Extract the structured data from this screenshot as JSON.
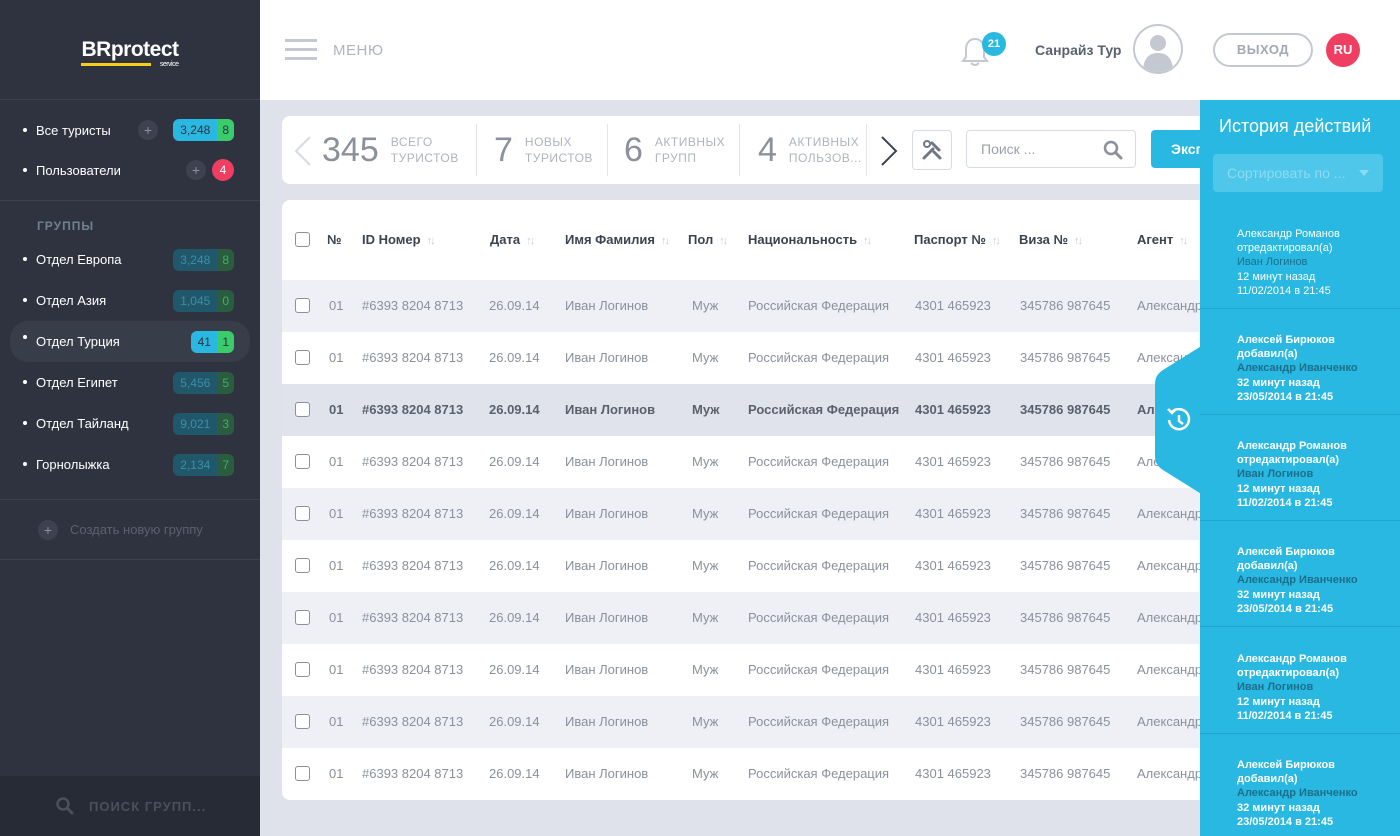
{
  "logo": {
    "brand": "BRprotect",
    "sub": "service"
  },
  "header": {
    "menu_label": "МЕНЮ",
    "notifications": "21",
    "user_name": "Санрайз Тур",
    "logout": "ВЫХОД",
    "lang": "RU"
  },
  "sidebar": {
    "top_items": [
      {
        "label": "Все туристы",
        "count": "3,248",
        "sub": "8"
      },
      {
        "label": "Пользователи",
        "count": "4"
      }
    ],
    "groups_title": "ГРУППЫ",
    "groups": [
      {
        "label": "Отдел Европа",
        "count": "3,248",
        "sub": "8"
      },
      {
        "label": "Отдел Азия",
        "count": "1,045",
        "sub": "0"
      },
      {
        "label": "Отдел Турция",
        "count": "41",
        "sub": "1"
      },
      {
        "label": "Отдел Египет",
        "count": "5,456",
        "sub": "5"
      },
      {
        "label": "Отдел Тайланд",
        "count": "9,021",
        "sub": "3"
      },
      {
        "label": "Горнолыжка",
        "count": "2,134",
        "sub": "7"
      }
    ],
    "create_group": "Создать новую группу",
    "search_placeholder": "ПОИСК ГРУПП..."
  },
  "stats": [
    {
      "num": "345",
      "l1": "ВСЕГО",
      "l2": "ТУРИСТОВ"
    },
    {
      "num": "7",
      "l1": "НОВЫХ",
      "l2": "ТУРИСТОВ"
    },
    {
      "num": "6",
      "l1": "АКТИВНЫХ",
      "l2": "ГРУПП"
    },
    {
      "num": "4",
      "l1": "АКТИВНЫХ",
      "l2": "ПОЛЬЗОВ..."
    }
  ],
  "toolbar": {
    "search_placeholder": "Поиск ...",
    "export_label": "Экспорт"
  },
  "table": {
    "headers": [
      "№",
      "ID Номер",
      "Дата",
      "Имя Фамилия",
      "Пол",
      "Национальность",
      "Паспорт №",
      "Виза №",
      "Агент"
    ],
    "rows": [
      {
        "n": "01",
        "id": "#6393 8204 8713",
        "date": "26.09.14",
        "name": "Иван Логинов",
        "sex": "Муж",
        "nat": "Российская Федерация",
        "pass": "4301  465923",
        "visa": "345786 987645",
        "agent": "Александр"
      },
      {
        "n": "01",
        "id": "#6393 8204 8713",
        "date": "26.09.14",
        "name": "Иван Логинов",
        "sex": "Муж",
        "nat": "Российская Федерация",
        "pass": "4301  465923",
        "visa": "345786 987645",
        "agent": "Александр"
      },
      {
        "n": "01",
        "id": "#6393 8204 8713",
        "date": "26.09.14",
        "name": "Иван Логинов",
        "sex": "Муж",
        "nat": "Российская Федерация",
        "pass": "4301  465923",
        "visa": "345786 987645",
        "agent": "Александр"
      },
      {
        "n": "01",
        "id": "#6393 8204 8713",
        "date": "26.09.14",
        "name": "Иван Логинов",
        "sex": "Муж",
        "nat": "Российская Федерация",
        "pass": "4301  465923",
        "visa": "345786 987645",
        "agent": "Александр"
      },
      {
        "n": "01",
        "id": "#6393 8204 8713",
        "date": "26.09.14",
        "name": "Иван Логинов",
        "sex": "Муж",
        "nat": "Российская Федерация",
        "pass": "4301  465923",
        "visa": "345786 987645",
        "agent": "Александр"
      },
      {
        "n": "01",
        "id": "#6393 8204 8713",
        "date": "26.09.14",
        "name": "Иван Логинов",
        "sex": "Муж",
        "nat": "Российская Федерация",
        "pass": "4301  465923",
        "visa": "345786 987645",
        "agent": "Александр"
      },
      {
        "n": "01",
        "id": "#6393 8204 8713",
        "date": "26.09.14",
        "name": "Иван Логинов",
        "sex": "Муж",
        "nat": "Российская Федерация",
        "pass": "4301  465923",
        "visa": "345786 987645",
        "agent": "Александр"
      },
      {
        "n": "01",
        "id": "#6393 8204 8713",
        "date": "26.09.14",
        "name": "Иван Логинов",
        "sex": "Муж",
        "nat": "Российская Федерация",
        "pass": "4301  465923",
        "visa": "345786 987645",
        "agent": "Александр"
      },
      {
        "n": "01",
        "id": "#6393 8204 8713",
        "date": "26.09.14",
        "name": "Иван Логинов",
        "sex": "Муж",
        "nat": "Российская Федерация",
        "pass": "4301  465923",
        "visa": "345786 987645",
        "agent": "Александр"
      },
      {
        "n": "01",
        "id": "#6393 8204 8713",
        "date": "26.09.14",
        "name": "Иван Логинов",
        "sex": "Муж",
        "nat": "Российская Федерация",
        "pass": "4301  465923",
        "visa": "345786 987645",
        "agent": "Александр"
      }
    ]
  },
  "history": {
    "title": "История действий",
    "sort_placeholder": "Сортировать по ...",
    "items": [
      {
        "user": "Александр Романов",
        "action": "отредактировал(а)",
        "target": "Иван Логинов",
        "ago": "12 минут назад",
        "when": "11/02/2014 в 21:45"
      },
      {
        "user": "Алексей Бирюков",
        "action": "добавил(а)",
        "target": "Александр Иванченко",
        "ago": "32 минут назад",
        "when": "23/05/2014 в 21:45"
      },
      {
        "user": "Александр Романов",
        "action": "отредактировал(а)",
        "target": "Иван Логинов",
        "ago": "12 минут назад",
        "when": "11/02/2014 в 21:45"
      },
      {
        "user": "Алексей Бирюков",
        "action": "добавил(а)",
        "target": "Александр Иванченко",
        "ago": "32 минут назад",
        "when": "23/05/2014 в 21:45"
      },
      {
        "user": "Александр Романов",
        "action": "отредактировал(а)",
        "target": "Иван Логинов",
        "ago": "12 минут назад",
        "when": "11/02/2014 в 21:45"
      },
      {
        "user": "Алексей Бирюков",
        "action": "добавил(а)",
        "target": "Александр Иванченко",
        "ago": "32 минут назад",
        "when": "23/05/2014 в 21:45"
      }
    ]
  },
  "colors": {
    "accent": "#29b8e1",
    "green": "#3acb6c",
    "red": "#f03e62",
    "sidebar": "#2e333f"
  }
}
